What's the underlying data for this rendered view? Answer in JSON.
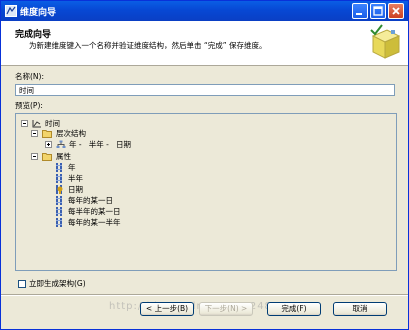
{
  "window": {
    "title": "维度向导"
  },
  "header": {
    "title": "完成向导",
    "description": "为新建维度键入一个名称并验证维度结构，然后单击 “完成” 保存维度。"
  },
  "name_field": {
    "label": "名称(N):",
    "value": "时间"
  },
  "preview": {
    "label": "预览(P):",
    "root": "时间",
    "hierarchies_folder": "层次结构",
    "hierarchy": "年 -   半年 -   日期",
    "attributes_folder": "属性",
    "attributes": [
      "年",
      "半年",
      "日期",
      "每年的某一日",
      "每半年的某一日",
      "每年的某一半年"
    ]
  },
  "process_checkbox": {
    "label": "立即生成架构(G)",
    "checked": false
  },
  "buttons": {
    "back": "< 上一步(B)",
    "next": "下一步(N) >",
    "finish": "完成(F)",
    "cancel": "取消"
  },
  "watermark": "http://blog.csdn.net/mn2481",
  "colors": {
    "titlebar": "#0748d4",
    "dialog_bg": "#ece9d8",
    "key_attribute": "#d4a017"
  }
}
